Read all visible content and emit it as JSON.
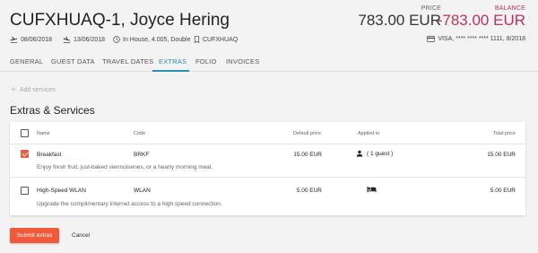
{
  "header": {
    "title": "CUFXHUAQ-1, Joyce Hering",
    "price_label": "PRICE",
    "price_value": "783.00 EUR",
    "balance_label": "BALANCE",
    "balance_value": "-783.00 EUR",
    "arrival": "08/06/2018",
    "departure": "13/06/2018",
    "status": "In House, 4.005, Double",
    "booking_ref": "CUFXHUAQ",
    "card": "VISA, **** **** **** 1111, 8/2018"
  },
  "tabs": [
    {
      "label": "GENERAL"
    },
    {
      "label": "GUEST DATA"
    },
    {
      "label": "TRAVEL DATES"
    },
    {
      "label": "EXTRAS"
    },
    {
      "label": "FOLIO"
    },
    {
      "label": "INVOICES"
    }
  ],
  "active_tab": "EXTRAS",
  "add_services_label": "Add services",
  "section_title": "Extras & Services",
  "table": {
    "headers": {
      "name": "Name",
      "code": "Code",
      "default_price": "Default price",
      "applied_to": "Applied to",
      "total_price": "Total price"
    },
    "rows": [
      {
        "checked": true,
        "name": "Breakfast",
        "code": "BRKF",
        "default_price": "15.00 EUR",
        "applied_to": "( 1 guest )",
        "applied_icon": "person-icon",
        "total_price": "15.00 EUR",
        "description": "Enjoy fresh fruit, just-baked viennoiseries, or a hearty morning meal."
      },
      {
        "checked": false,
        "name": "High-Speed WLAN",
        "code": "WLAN",
        "default_price": "5.00 EUR",
        "applied_to": "",
        "applied_icon": "bed-icon",
        "total_price": "5.00 EUR",
        "description": "Upgrade the complimentary internet access to a high speed connection."
      }
    ]
  },
  "buttons": {
    "submit": "Submit extras",
    "cancel": "Cancel"
  },
  "colors": {
    "accent": "#f05a3a",
    "tab_active": "#2a8fb3",
    "balance": "#c0305a"
  }
}
